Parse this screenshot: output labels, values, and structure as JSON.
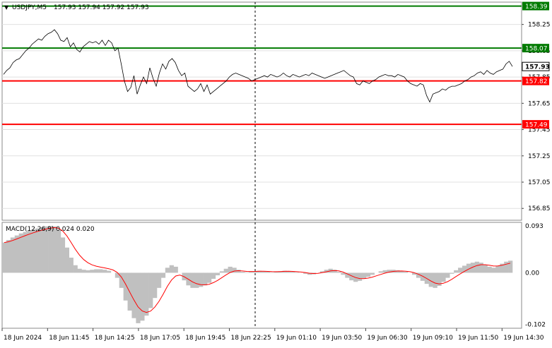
{
  "chart_data": {
    "type": "line",
    "symbol": "USDJPY,M5",
    "ohlc_text": "157.93 157.94 157.92 157.93",
    "price_axis": {
      "ylim": [
        156.76,
        158.42
      ],
      "ticks": [
        "158.25",
        "158.05",
        "157.85",
        "157.65",
        "157.45",
        "157.25",
        "157.05",
        "156.85"
      ]
    },
    "levels": [
      {
        "label": "158.39",
        "value": 158.39,
        "color": "#007a00"
      },
      {
        "label": "158.07",
        "value": 158.07,
        "color": "#007a00"
      },
      {
        "label": "157.82",
        "value": 157.82,
        "color": "#ff0000"
      },
      {
        "label": "157.49",
        "value": 157.49,
        "color": "#ff0000"
      }
    ],
    "last_price": {
      "label": "157.93",
      "value": 157.93
    },
    "price_series": [
      157.87,
      157.9,
      157.92,
      157.96,
      157.98,
      157.99,
      158.02,
      158.05,
      158.07,
      158.1,
      158.12,
      158.14,
      158.13,
      158.16,
      158.18,
      158.19,
      158.21,
      158.18,
      158.13,
      158.12,
      158.15,
      158.08,
      158.11,
      158.06,
      158.04,
      158.08,
      158.1,
      158.12,
      158.11,
      158.12,
      158.1,
      158.13,
      158.09,
      158.13,
      158.11,
      158.05,
      158.07,
      157.95,
      157.82,
      157.74,
      157.77,
      157.86,
      157.72,
      157.79,
      157.85,
      157.8,
      157.92,
      157.84,
      157.78,
      157.88,
      157.95,
      157.91,
      157.97,
      157.99,
      157.96,
      157.9,
      157.86,
      157.88,
      157.78,
      157.76,
      157.74,
      157.76,
      157.8,
      157.74,
      157.79,
      157.72,
      157.74,
      157.76,
      157.78,
      157.8,
      157.82,
      157.85,
      157.87,
      157.88,
      157.87,
      157.86,
      157.85,
      157.84,
      157.82,
      157.83,
      157.84,
      157.85,
      157.86,
      157.85,
      157.87,
      157.86,
      157.85,
      157.86,
      157.88,
      157.86,
      157.85,
      157.87,
      157.86,
      157.85,
      157.86,
      157.87,
      157.86,
      157.88,
      157.87,
      157.86,
      157.85,
      157.84,
      157.85,
      157.86,
      157.87,
      157.88,
      157.89,
      157.9,
      157.88,
      157.86,
      157.85,
      157.8,
      157.79,
      157.82,
      157.81,
      157.8,
      157.82,
      157.83,
      157.85,
      157.86,
      157.87,
      157.86,
      157.86,
      157.85,
      157.87,
      157.86,
      157.85,
      157.82,
      157.8,
      157.79,
      157.78,
      157.8,
      157.79,
      157.71,
      157.66,
      157.72,
      157.73,
      157.74,
      157.76,
      157.75,
      157.77,
      157.78,
      157.78,
      157.79,
      157.8,
      157.82,
      157.83,
      157.85,
      157.86,
      157.88,
      157.89,
      157.87,
      157.9,
      157.88,
      157.87,
      157.89,
      157.9,
      157.91,
      157.95,
      157.97,
      157.93
    ],
    "macd": {
      "label": "MACD(12,26,9) 0.024 0.020",
      "ylim": [
        -0.11,
        0.1
      ],
      "ticks": [
        "0.093",
        "0.00",
        "-0.102"
      ],
      "histogram": [
        0.06,
        0.065,
        0.07,
        0.074,
        0.078,
        0.081,
        0.084,
        0.086,
        0.088,
        0.09,
        0.092,
        0.093,
        0.092,
        0.085,
        0.07,
        0.05,
        0.03,
        0.015,
        0.008,
        0.006,
        0.005,
        0.006,
        0.007,
        0.007,
        0.006,
        0.004,
        0.0,
        -0.01,
        -0.03,
        -0.055,
        -0.075,
        -0.09,
        -0.1,
        -0.095,
        -0.085,
        -0.07,
        -0.05,
        -0.03,
        -0.01,
        0.01,
        0.015,
        0.012,
        0.0,
        -0.015,
        -0.025,
        -0.03,
        -0.03,
        -0.028,
        -0.025,
        -0.02,
        -0.012,
        -0.005,
        0.003,
        0.008,
        0.012,
        0.01,
        0.006,
        0.002,
        0.001,
        0.002,
        0.003,
        0.004,
        0.003,
        0.002,
        0.001,
        0.002,
        0.003,
        0.004,
        0.003,
        0.002,
        0.001,
        0.0,
        -0.002,
        -0.004,
        -0.003,
        0.0,
        0.003,
        0.006,
        0.008,
        0.006,
        0.002,
        -0.004,
        -0.01,
        -0.015,
        -0.018,
        -0.016,
        -0.012,
        -0.008,
        -0.004,
        0.0,
        0.003,
        0.005,
        0.006,
        0.006,
        0.005,
        0.004,
        0.002,
        0.0,
        -0.004,
        -0.01,
        -0.016,
        -0.022,
        -0.028,
        -0.03,
        -0.026,
        -0.018,
        -0.01,
        -0.002,
        0.005,
        0.01,
        0.014,
        0.018,
        0.02,
        0.022,
        0.02,
        0.016,
        0.012,
        0.01,
        0.014,
        0.018,
        0.022,
        0.024
      ]
    },
    "x_axis": {
      "ticks": [
        "18 Jun 2024",
        "18 Jun 11:45",
        "18 Jun 14:25",
        "18 Jun 17:05",
        "18 Jun 19:45",
        "18 Jun 22:25",
        "19 Jun 01:10",
        "19 Jun 03:50",
        "19 Jun 06:30",
        "19 Jun 09:10",
        "19 Jun 11:50",
        "19 Jun 14:30"
      ]
    },
    "colors": {
      "price": "#000000",
      "macd_signal": "#ff0000",
      "macd_hist": "#c0c0c0",
      "grid": "#e0e0e0"
    }
  }
}
